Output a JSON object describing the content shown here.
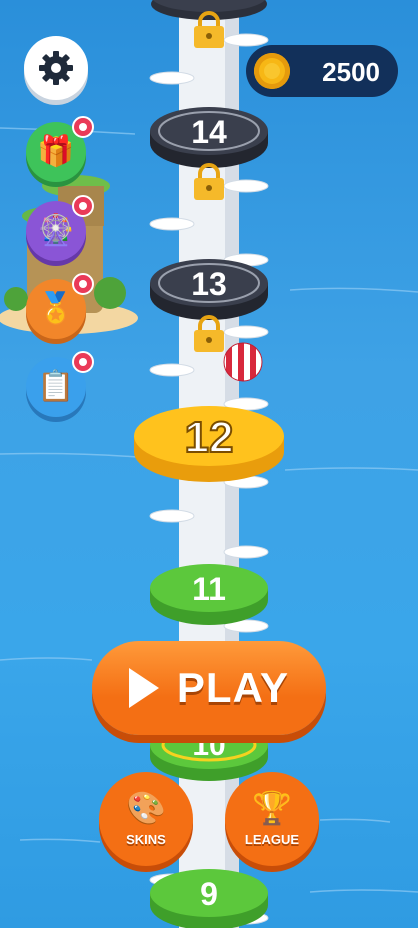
{
  "coins": {
    "amount": "2500"
  },
  "tower": {
    "levels": [
      {
        "label": "14",
        "state": "locked"
      },
      {
        "label": "13",
        "state": "locked"
      },
      {
        "label": "12",
        "state": "current"
      },
      {
        "label": "11",
        "state": "completed"
      },
      {
        "label": "10",
        "state": "completed"
      },
      {
        "label": "9",
        "state": "completed"
      }
    ]
  },
  "sidebar": {
    "items": [
      {
        "name": "gift",
        "icon": "🎁"
      },
      {
        "name": "wheel",
        "icon": "🎡"
      },
      {
        "name": "medal",
        "icon": "🏅"
      },
      {
        "name": "tasks",
        "icon": "📋"
      }
    ]
  },
  "play": {
    "label": "PLAY"
  },
  "skins": {
    "label": "SKINS",
    "icon": "🎨"
  },
  "league": {
    "label": "LEAGUE",
    "icon": "🏆"
  },
  "colors": {
    "locked": "#3a3f4d",
    "current": "#ffc21d",
    "completed": "#5cc83c",
    "accent": "#f46f14",
    "coin": "#f7b715"
  }
}
